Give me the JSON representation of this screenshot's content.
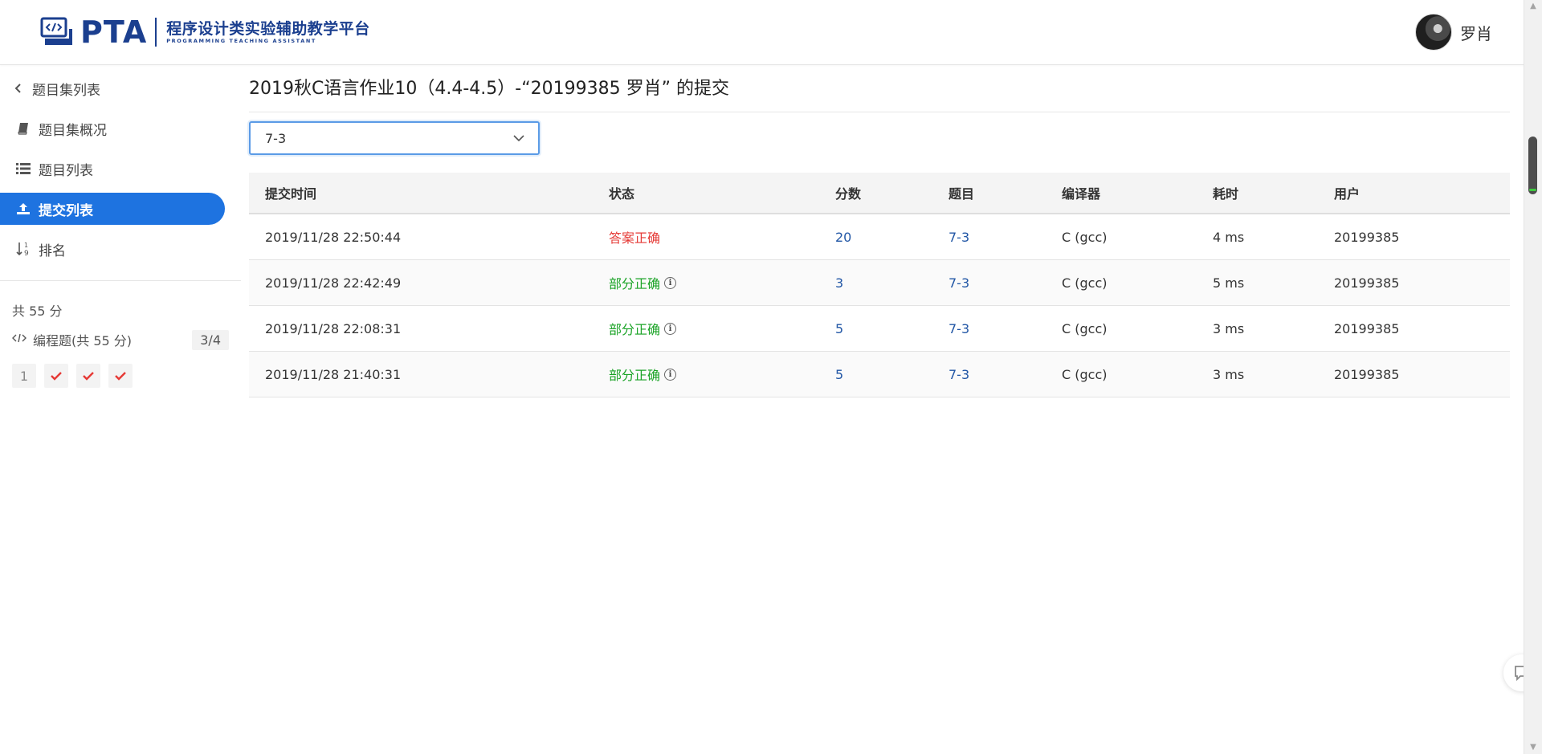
{
  "header": {
    "logo_text": "PTA",
    "logo_cn": "程序设计类实验辅助教学平台",
    "logo_en": "PROGRAMMING TEACHING ASSISTANT",
    "user_name": "罗肖"
  },
  "sidebar": {
    "items": [
      {
        "label": "题目集列表",
        "icon": "chevron-left-icon"
      },
      {
        "label": "题目集概况",
        "icon": "book-icon"
      },
      {
        "label": "题目列表",
        "icon": "list-icon"
      },
      {
        "label": "提交列表",
        "icon": "upload-icon",
        "active": true
      },
      {
        "label": "排名",
        "icon": "sort-numeric-icon"
      }
    ],
    "total": "共 55 分",
    "section_label": "编程题(共 55 分)",
    "section_progress": "3/4",
    "problem_first": "1",
    "problems": [
      "1",
      "check",
      "check",
      "check"
    ]
  },
  "main": {
    "title": "2019秋C语言作业10（4.4-4.5）-“20199385 罗肖” 的提交",
    "select_value": "7-3",
    "table": {
      "headers": {
        "time": "提交时间",
        "status": "状态",
        "score": "分数",
        "problem": "题目",
        "compiler": "编译器",
        "cost": "耗时",
        "user": "用户"
      },
      "rows": [
        {
          "time": "2019/11/28 22:50:44",
          "status": "答案正确",
          "score": "20",
          "problem": "7-3",
          "compiler": "C (gcc)",
          "cost": "4 ms",
          "user": "20199385"
        },
        {
          "time": "2019/11/28 22:42:49",
          "status": "部分正确",
          "score": "3",
          "problem": "7-3",
          "compiler": "C (gcc)",
          "cost": "5 ms",
          "user": "20199385"
        },
        {
          "time": "2019/11/28 22:08:31",
          "status": "部分正确",
          "score": "5",
          "problem": "7-3",
          "compiler": "C (gcc)",
          "cost": "3 ms",
          "user": "20199385"
        },
        {
          "time": "2019/11/28 21:40:31",
          "status": "部分正确",
          "score": "5",
          "problem": "7-3",
          "compiler": "C (gcc)",
          "cost": "3 ms",
          "user": "20199385"
        }
      ]
    }
  },
  "colors": {
    "brand": "#1b3f8f",
    "active_nav": "#1e73e0",
    "status_correct": "#e53935",
    "status_partial": "#1aa326",
    "link": "#2156a5"
  }
}
